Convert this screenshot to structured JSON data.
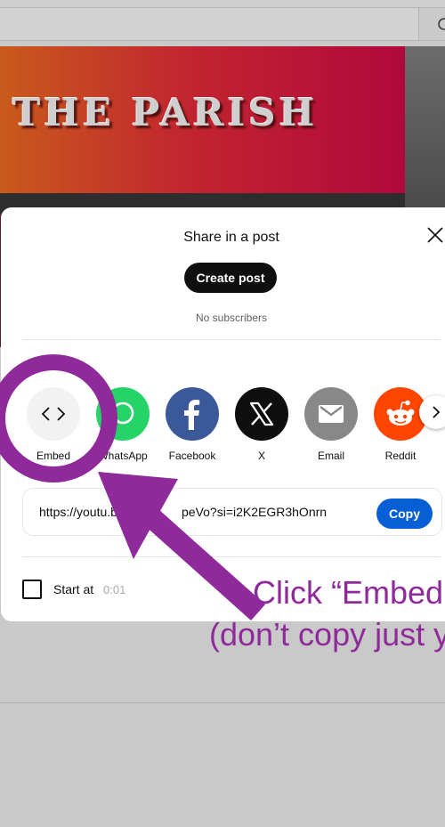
{
  "background": {
    "video_title_sign": "THE PARISH"
  },
  "modal": {
    "title": "Share in a post",
    "create_post_label": "Create post",
    "subscribers_text": "No subscribers",
    "share_targets": [
      {
        "label": "Embed",
        "icon": "embed-code-icon",
        "color": "#f2f2f2"
      },
      {
        "label": "WhatsApp",
        "icon": "whatsapp-icon",
        "color": "#25d366"
      },
      {
        "label": "Facebook",
        "icon": "facebook-icon",
        "color": "#3b5998"
      },
      {
        "label": "X",
        "icon": "x-icon",
        "color": "#0f0f0f"
      },
      {
        "label": "Email",
        "icon": "email-icon",
        "color": "#888888"
      },
      {
        "label": "Reddit",
        "icon": "reddit-icon",
        "color": "#ff4500"
      }
    ],
    "share_url": "https://youtu.be/●●●●●●peVo?si=i2K2EGR3hOnrn",
    "share_url_visible_left": "https://youtu.b",
    "share_url_visible_right": "peVo?si=i2K2EGR3hOnrn",
    "copy_label": "Copy",
    "start_at_label": "Start at",
    "start_at_time": "0:01"
  },
  "annotation": {
    "line1": "Click “Embed",
    "line2": "(don’t copy just y",
    "color": "#8e2a9a"
  }
}
